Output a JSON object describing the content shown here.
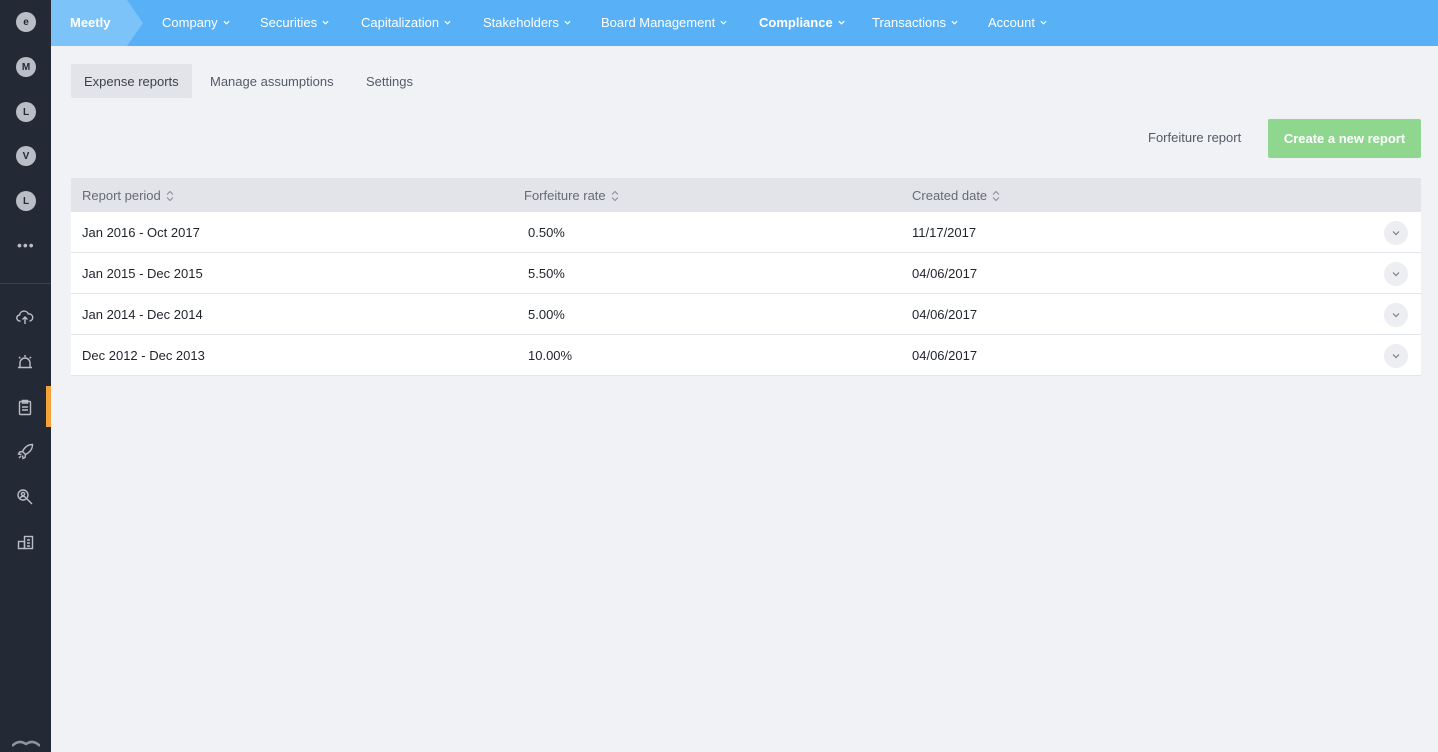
{
  "rail": {
    "orgs": [
      "e",
      "M",
      "L",
      "V",
      "L"
    ],
    "more": "•••"
  },
  "topbar": {
    "brand": "Meetly",
    "menu": [
      "Company",
      "Securities",
      "Capitalization",
      "Stakeholders",
      "Board Management",
      "Compliance",
      "Transactions",
      "Account"
    ],
    "active_menu": "Compliance"
  },
  "tabs": [
    "Expense reports",
    "Manage assumptions",
    "Settings"
  ],
  "actions": {
    "forfeiture_report": "Forfeiture report",
    "create_report": "Create a new report"
  },
  "table": {
    "headers": [
      "Report period",
      "Forfeiture rate",
      "Created date"
    ],
    "rows": [
      {
        "period": "Jan 2016 - Oct 2017",
        "rate": "0.50%",
        "created": "11/17/2017"
      },
      {
        "period": "Jan 2015 - Dec 2015",
        "rate": "5.50%",
        "created": "04/06/2017"
      },
      {
        "period": "Jan 2014 - Dec 2014",
        "rate": "5.00%",
        "created": "04/06/2017"
      },
      {
        "period": "Dec 2012 - Dec 2013",
        "rate": "10.00%",
        "created": "04/06/2017"
      }
    ]
  },
  "colors": {
    "topbar": "#58b1f6",
    "rail": "#232a36",
    "primary_button": "#8fd68f",
    "active_indicator": "#f6a23b"
  }
}
